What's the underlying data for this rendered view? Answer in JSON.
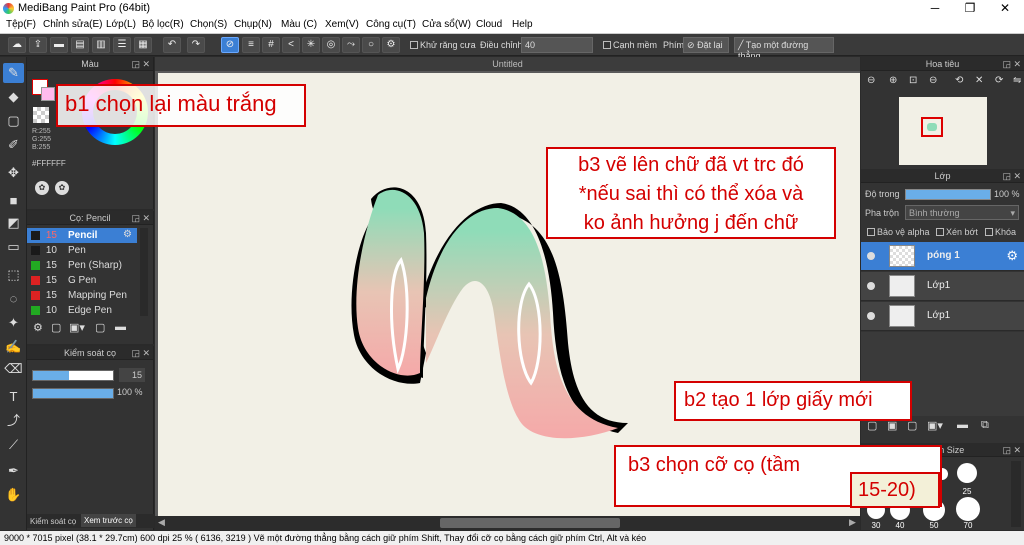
{
  "window": {
    "title": "MediBang Paint Pro (64bit)",
    "minimize": "─",
    "maximize": "❐",
    "close": "✕"
  },
  "menu": [
    "Tệp(F)",
    "Chỉnh sửa(E)",
    "Lớp(L)",
    "Bộ lọc(R)",
    "Chọn(S)",
    "Chụp(N)",
    "Màu (C)",
    "Xem(V)",
    "Công cụ(T)",
    "Cửa sổ(W)",
    "Cloud",
    "Help"
  ],
  "toolbar": {
    "antialias": "Khử răng cưa",
    "adjust_label": "Điều chỉnh",
    "adjust_value": "40",
    "snap": "Cạnh mềm",
    "key_label": "Phím",
    "reset": "Đặt lại",
    "make_line": "Tạo một đường thẳng"
  },
  "color_panel": {
    "title": "Màu",
    "r": "R:255",
    "g": "G:255",
    "b": "B:255",
    "hex": "#FFFFFF"
  },
  "brush_panel": {
    "title": "Cọ: Pencil",
    "items": [
      {
        "size": "15",
        "name": "Pencil",
        "color": "#1a1a1a",
        "selected": true
      },
      {
        "size": "10",
        "name": "Pen",
        "color": "#1a1a1a"
      },
      {
        "size": "15",
        "name": "Pen (Sharp)",
        "color": "#22aa22"
      },
      {
        "size": "15",
        "name": "G Pen",
        "color": "#dd2222"
      },
      {
        "size": "15",
        "name": "Mapping Pen",
        "color": "#dd2222"
      },
      {
        "size": "10",
        "name": "Edge Pen",
        "color": "#22aa22"
      }
    ]
  },
  "brush_control": {
    "title": "Kiểm soát cọ",
    "size": "15",
    "size_fraction": 0.45,
    "opacity": "100 %",
    "opacity_fraction": 1.0
  },
  "left_tabs": {
    "control": "Kiểm soát cọ",
    "preview": "Xem trước cọ"
  },
  "document": {
    "tab": "Untitled"
  },
  "navigator": {
    "title": "Hoa tiêu"
  },
  "layer_panel": {
    "title": "Lớp",
    "opacity_label": "Độ trong",
    "opacity_value": "100 %",
    "blend_label": "Pha trộn",
    "blend_value": "Bình thường",
    "protect_alpha": "Bảo vệ alpha",
    "clip": "Xén bớt",
    "lock": "Khóa",
    "layers": [
      {
        "name": "póng 1",
        "selected": true
      },
      {
        "name": "Lớp1"
      },
      {
        "name": "Lớp1"
      }
    ]
  },
  "brush_size": {
    "title": "Brush Size",
    "row1": [
      "",
      "",
      "",
      "",
      "25"
    ],
    "row2": [
      "30",
      "40",
      "50",
      "70"
    ]
  },
  "status": "9000 * 7015 pixel   (38.1 * 29.7cm)   600 dpi   25 %   ( 6136, 3219 )   Vẽ một đường thẳng bằng cách giữ phím Shift, Thay đổi cỡ cọ bằng cách giữ phím Ctrl, Alt và kéo",
  "annotations": {
    "a1": "b1 chọn lại màu trắng",
    "a3_lines": [
      "b3 vẽ lên chữ đã vt trc đó",
      "*nếu sai thì có thể xóa và",
      "ko ảnh hưởng j đến chữ"
    ],
    "a2": "b2 tạo 1 lớp giấy mới",
    "a4": "b3 chọn cỡ cọ (tầm",
    "a4b": "15-20)"
  },
  "colors": {
    "accent": "#3b7fd4",
    "annotation": "#d40000",
    "mint": "#8fdcb8",
    "pink": "#f5a9a9"
  }
}
